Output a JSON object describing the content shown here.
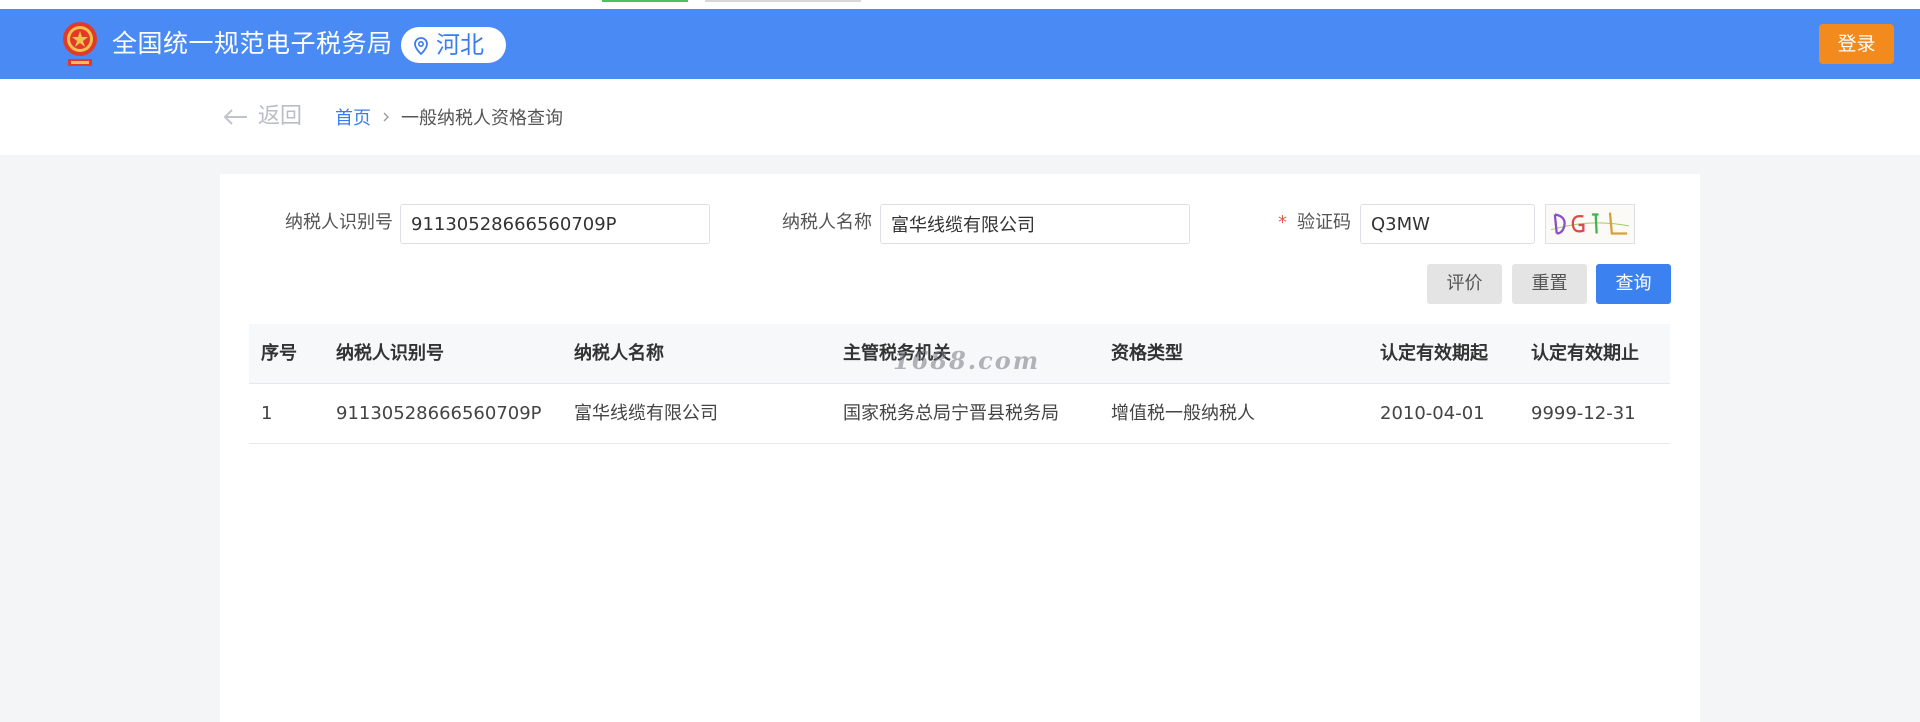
{
  "header": {
    "site_title": "全国统一规范电子税务局",
    "region": "河北",
    "login_label": "登录",
    "emblem_icon": "national-emblem-icon",
    "pin_icon": "location-pin-icon",
    "brand_color": "#4a8af4",
    "login_color": "#f28a1d"
  },
  "subnav": {
    "back_label": "返回",
    "breadcrumb": {
      "home": "首页",
      "current": "一般纳税人资格查询"
    }
  },
  "form": {
    "taxpayer_id": {
      "label": "纳税人识别号",
      "value": "91130528666560709P"
    },
    "taxpayer_name": {
      "label": "纳税人名称",
      "value": "富华线缆有限公司"
    },
    "captcha": {
      "required_mark": "*",
      "label": "验证码",
      "value": "Q3MW"
    },
    "buttons": {
      "evaluate": "评价",
      "reset": "重置",
      "query": "查询"
    }
  },
  "table": {
    "columns": [
      "序号",
      "纳税人识别号",
      "纳税人名称",
      "主管税务机关",
      "资格类型",
      "认定有效期起",
      "认定有效期止"
    ],
    "rows": [
      [
        "1",
        "91130528666560709P",
        "富华线缆有限公司",
        "国家税务总局宁晋县税务局",
        "增值税一般纳税人",
        "2010-04-01",
        "9999-12-31"
      ]
    ]
  },
  "watermark": "1688.com"
}
